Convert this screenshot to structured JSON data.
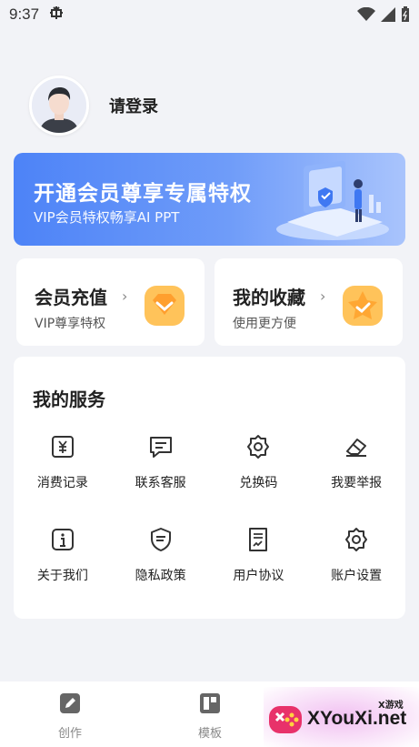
{
  "status_bar": {
    "time": "9:37",
    "notification_icon": "bug-icon"
  },
  "profile": {
    "login_text": "请登录"
  },
  "vip_banner": {
    "title": "开通会员尊享专属特权",
    "subtitle": "VIP会员特权畅享AI PPT"
  },
  "cards": [
    {
      "title": "会员充值",
      "subtitle": "VIP尊享特权",
      "icon": "diamond-icon"
    },
    {
      "title": "我的收藏",
      "subtitle": "使用更方便",
      "icon": "star-icon"
    }
  ],
  "services": {
    "title": "我的服务",
    "items": [
      {
        "label": "消费记录",
        "icon": "receipt-icon"
      },
      {
        "label": "联系客服",
        "icon": "message-icon"
      },
      {
        "label": "兑换码",
        "icon": "gear-badge-icon"
      },
      {
        "label": "我要举报",
        "icon": "eraser-icon"
      },
      {
        "label": "关于我们",
        "icon": "info-icon"
      },
      {
        "label": "隐私政策",
        "icon": "shield-icon"
      },
      {
        "label": "用户协议",
        "icon": "document-icon"
      },
      {
        "label": "账户设置",
        "icon": "settings-icon"
      }
    ]
  },
  "bottom_nav": [
    {
      "label": "创作",
      "icon": "edit-icon"
    },
    {
      "label": "模板",
      "icon": "template-icon"
    }
  ],
  "watermark": {
    "site": "XYouXi.net",
    "tag": "X游戏"
  },
  "colors": {
    "accent": "#4d83f7",
    "background": "#f2f3f7"
  }
}
